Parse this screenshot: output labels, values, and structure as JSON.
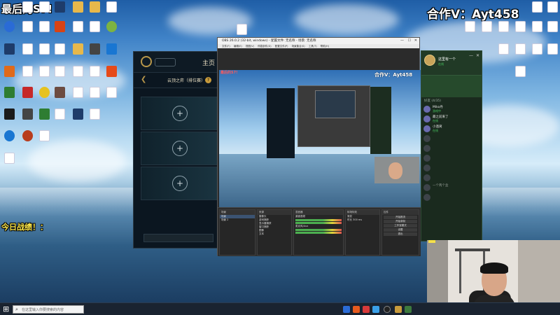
{
  "overlay": {
    "title": "最后的S7!",
    "partner": "合作V：Ayt458",
    "today": "今日战绩！："
  },
  "desktop_icons": [
    "",
    "",
    "",
    "",
    "",
    "",
    "",
    "",
    "",
    "",
    "",
    "",
    "",
    "",
    "",
    ""
  ],
  "league": {
    "home_label": "主页",
    "mode_label": "云顶之弈（排位赛）"
  },
  "obs": {
    "title": "OBS 26.0.2 (32-bit, windows) - 配置文件: 无名称 - 场景: 无名称",
    "menu": "文件(F) 编辑(E) 视图(V) 停靠部件(D) 配置文件(P) 场景集合(S) 工具(T) 帮助(H)",
    "preview_title": "最后的S7!",
    "preview_partner": "合作V：Ayt458",
    "docks": [
      {
        "header": "场景",
        "rows": [
          "场景",
          "场景 2"
        ]
      },
      {
        "header": "来源",
        "rows": [
          "摄像头",
          "游戏捕获",
          "显示器捕获",
          "窗口捕获",
          "图像",
          "文本"
        ]
      },
      {
        "header": "混音器",
        "rows": [
          "桌面音频",
          "麦克风/Aux"
        ]
      },
      {
        "header": "转场特效",
        "rows": [
          "渐变",
          "时长 300 ms"
        ]
      },
      {
        "header": "控件",
        "buttons": [
          "开始推流",
          "开始录制",
          "工作室模式",
          "设置",
          "退出"
        ]
      }
    ]
  },
  "friends": {
    "user_name": "这里有一个",
    "user_status": "在线",
    "section": "好友 (4/35)",
    "list": [
      {
        "name": "Miko丹",
        "status": "游戏中",
        "online": true
      },
      {
        "name": "最之前来了",
        "status": "在线",
        "online": true
      },
      {
        "name": "小酒窝",
        "status": "在线",
        "online": true
      },
      {
        "name": "",
        "status": "",
        "online": false
      },
      {
        "name": "",
        "status": "",
        "online": false
      },
      {
        "name": "",
        "status": "",
        "online": false
      },
      {
        "name": "",
        "status": "",
        "online": false
      },
      {
        "name": "",
        "status": "",
        "online": false
      },
      {
        "name": "一个两个盒",
        "status": "",
        "online": false
      },
      {
        "name": "",
        "status": "",
        "online": false
      }
    ]
  },
  "taskbar": {
    "search_placeholder": "在这里输入你要搜索的内容"
  }
}
